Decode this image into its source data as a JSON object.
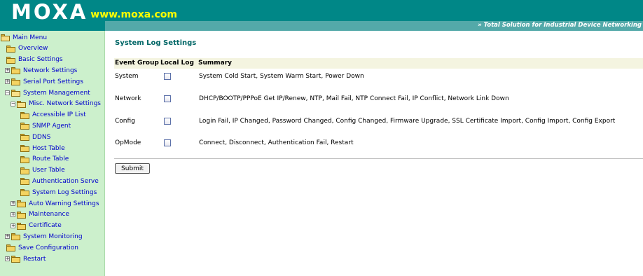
{
  "header": {
    "logo_text": "MOXA",
    "logo_url": "www.moxa.com",
    "tagline": "» Total Solution for Industrial Device Networking"
  },
  "sidebar": {
    "items": [
      {
        "label": "Main Menu",
        "level": 0,
        "icon": "folder-open-icon",
        "expander": "none"
      },
      {
        "label": "Overview",
        "level": 1,
        "icon": "folder-icon",
        "expander": "none"
      },
      {
        "label": "Basic Settings",
        "level": 1,
        "icon": "folder-icon",
        "expander": "none"
      },
      {
        "label": "Network Settings",
        "level": 1,
        "icon": "folder-icon",
        "expander": "plus"
      },
      {
        "label": "Serial Port Settings",
        "level": 1,
        "icon": "folder-icon",
        "expander": "plus"
      },
      {
        "label": "System Management",
        "level": 1,
        "icon": "folder-open-icon",
        "expander": "minus"
      },
      {
        "label": "Misc. Network Settings",
        "level": 2,
        "icon": "folder-open-icon",
        "expander": "minus"
      },
      {
        "label": "Accessible IP List",
        "level": 3,
        "icon": "folder-icon",
        "expander": "none"
      },
      {
        "label": "SNMP Agent",
        "level": 3,
        "icon": "folder-icon",
        "expander": "none"
      },
      {
        "label": "DDNS",
        "level": 3,
        "icon": "folder-icon",
        "expander": "none"
      },
      {
        "label": "Host Table",
        "level": 3,
        "icon": "folder-icon",
        "expander": "none"
      },
      {
        "label": "Route Table",
        "level": 3,
        "icon": "folder-icon",
        "expander": "none"
      },
      {
        "label": "User Table",
        "level": 3,
        "icon": "folder-icon",
        "expander": "none"
      },
      {
        "label": "Authentication Serve",
        "level": 3,
        "icon": "folder-icon",
        "expander": "none"
      },
      {
        "label": "System Log Settings",
        "level": 3,
        "icon": "folder-icon",
        "expander": "none"
      },
      {
        "label": "Auto Warning Settings",
        "level": 2,
        "icon": "folder-icon",
        "expander": "plus"
      },
      {
        "label": "Maintenance",
        "level": 2,
        "icon": "folder-icon",
        "expander": "plus"
      },
      {
        "label": "Certificate",
        "level": 2,
        "icon": "folder-icon",
        "expander": "plus"
      },
      {
        "label": "System Monitoring",
        "level": 1,
        "icon": "folder-icon",
        "expander": "plus"
      },
      {
        "label": "Save Configuration",
        "level": 1,
        "icon": "folder-icon",
        "expander": "none"
      },
      {
        "label": "Restart",
        "level": 1,
        "icon": "folder-icon",
        "expander": "plus"
      }
    ]
  },
  "main": {
    "title": "System Log Settings",
    "columns": {
      "group": "Event Group",
      "local_log": "Local Log",
      "summary": "Summary"
    },
    "rows": [
      {
        "group": "System",
        "checked": false,
        "summary": "System Cold Start, System Warm Start, Power Down"
      },
      {
        "group": "Network",
        "checked": false,
        "summary": "DHCP/BOOTP/PPPoE Get IP/Renew, NTP, Mail Fail, NTP Connect Fail, IP Conflict, Network Link Down"
      },
      {
        "group": "Config",
        "checked": false,
        "summary": "Login Fail, IP Changed, Password Changed, Config Changed, Firmware Upgrade, SSL Certificate Import, Config Import, Config Export"
      },
      {
        "group": "OpMode",
        "checked": false,
        "summary": "Connect, Disconnect, Authentication Fail, Restart"
      }
    ],
    "submit_label": "Submit"
  },
  "colors": {
    "header_bg": "#008787",
    "tagline_bar": "#53a9a9",
    "url_yellow": "#ffff00",
    "sidebar_bg": "#ccf0cc",
    "link_blue": "#0000cc",
    "title_teal": "#006666",
    "column_header_bg": "#f4f4e0"
  }
}
